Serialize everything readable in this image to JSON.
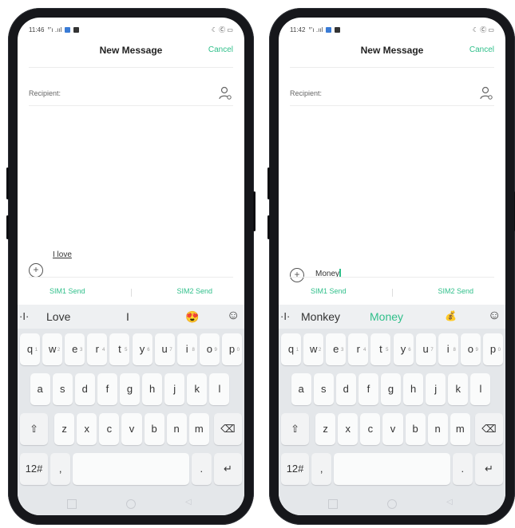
{
  "left": {
    "status": {
      "time": "11:46",
      "signal": "°’ı .ııl",
      "right": "☾ Ⓒ ▭"
    },
    "header": {
      "title": "New Message",
      "cancel": "Cancel"
    },
    "recipient": {
      "label": "Recipient:"
    },
    "message": {
      "text": "I love"
    },
    "sim": {
      "sim1": "SIM1 Send",
      "sim2": "SIM2 Send"
    },
    "suggestions": {
      "s1": "Love",
      "s2": "I",
      "emoji": "😍",
      "smiley": "☺"
    },
    "keys": {
      "row1": [
        "q",
        "w",
        "e",
        "r",
        "t",
        "y",
        "u",
        "i",
        "o",
        "p"
      ],
      "row1_hints": [
        "1",
        "2",
        "3",
        "4",
        "5",
        "6",
        "7",
        "8",
        "9",
        "0"
      ],
      "row2": [
        "a",
        "s",
        "d",
        "f",
        "g",
        "h",
        "j",
        "k",
        "l"
      ],
      "row3": [
        "z",
        "x",
        "c",
        "v",
        "b",
        "n",
        "m"
      ],
      "shift": "⇧",
      "backspace": "⌫",
      "num": "12#",
      "comma": ",",
      "period": ".",
      "enter": "↵"
    }
  },
  "right": {
    "status": {
      "time": "11:42",
      "signal": "°’ı .ııl",
      "right": "☾ Ⓒ ▭"
    },
    "header": {
      "title": "New Message",
      "cancel": "Cancel"
    },
    "recipient": {
      "label": "Recipient:"
    },
    "message": {
      "text": "Money"
    },
    "sim": {
      "sim1": "SIM1 Send",
      "sim2": "SIM2 Send"
    },
    "suggestions": {
      "s1": "Monkey",
      "s2": "Money",
      "emoji": "💰",
      "smiley": "☺"
    },
    "keys": {
      "row1": [
        "q",
        "w",
        "e",
        "r",
        "t",
        "y",
        "u",
        "i",
        "o",
        "p"
      ],
      "row1_hints": [
        "1",
        "2",
        "3",
        "4",
        "5",
        "6",
        "7",
        "8",
        "9",
        "0"
      ],
      "row2": [
        "a",
        "s",
        "d",
        "f",
        "g",
        "h",
        "j",
        "k",
        "l"
      ],
      "row3": [
        "z",
        "x",
        "c",
        "v",
        "b",
        "n",
        "m"
      ],
      "shift": "⇧",
      "backspace": "⌫",
      "num": "12#",
      "comma": ",",
      "period": ".",
      "enter": "↵"
    }
  },
  "colors": {
    "accent": "#2fbf8a",
    "keyboard_bg": "#e4e7ea",
    "frame": "#16171b"
  }
}
